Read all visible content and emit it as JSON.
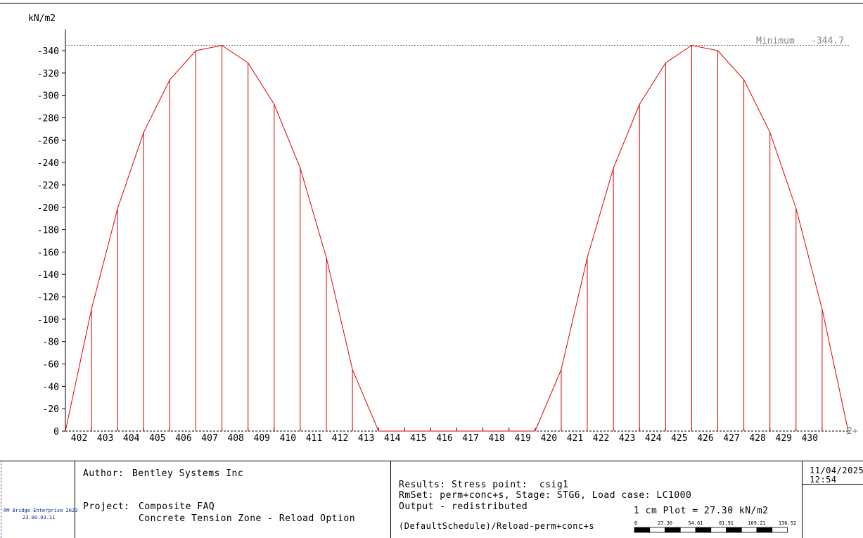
{
  "chart_data": {
    "type": "line",
    "ylabel": "kN/m2",
    "ylim": [
      0,
      -360
    ],
    "yticks": [
      0,
      -20,
      -40,
      -60,
      -80,
      -100,
      -120,
      -140,
      -160,
      -180,
      -200,
      -220,
      -240,
      -260,
      -280,
      -300,
      -320,
      -340
    ],
    "x_positions": [
      401,
      402,
      403,
      404,
      405,
      406,
      407,
      408,
      409,
      410,
      411,
      412,
      413,
      414,
      415,
      416,
      417,
      418,
      419,
      420,
      421,
      422,
      423,
      424,
      425,
      426,
      427,
      428,
      429,
      430,
      431
    ],
    "x_tick_labels": [
      "402",
      "403",
      "404",
      "405",
      "406",
      "407",
      "408",
      "409",
      "410",
      "411",
      "412",
      "413",
      "414",
      "415",
      "416",
      "417",
      "418",
      "419",
      "420",
      "421",
      "422",
      "423",
      "424",
      "425",
      "426",
      "427",
      "428",
      "429",
      "430"
    ],
    "values": [
      0,
      -109,
      -199,
      -267,
      -314,
      -340,
      -344.7,
      -329,
      -292,
      -235,
      -155,
      -55,
      0,
      0,
      0,
      0,
      0,
      0,
      0,
      -55,
      -155,
      -235,
      -292,
      -329,
      -344.7,
      -340,
      -314,
      -267,
      -199,
      -109,
      0
    ],
    "series_color": "#e00000",
    "minimum_line": {
      "label": "Minimum",
      "value": -344.7,
      "value_text": "-344.7"
    },
    "end_marker": "2+",
    "grid": false
  },
  "title_block": {
    "author_label": "Author:",
    "author_value": "Bentley Systems Inc",
    "project_label": "Project:",
    "project_line1": "Composite FAQ",
    "project_line2": "Concrete Tension Zone - Reload Option",
    "logo_line1": "RM Bridge Enterprise 2023",
    "logo_line2": "23.00.03.11",
    "results_line": "Results: Stress point:  csig1",
    "rmset_line": "RmSet: perm+conc+s, Stage: STG6, Load case: LC1000",
    "output_line": "Output - redistributed",
    "schedule_line": "(DefaultSchedule)/Reload-perm+conc+s",
    "plot_scale": "1 cm Plot = 27.30 kN/m2",
    "scale_labels": [
      "0",
      "27.30",
      "54.61",
      "81.91",
      "109.21",
      "136.52"
    ],
    "date": "11/04/2025",
    "time": "12:54"
  }
}
